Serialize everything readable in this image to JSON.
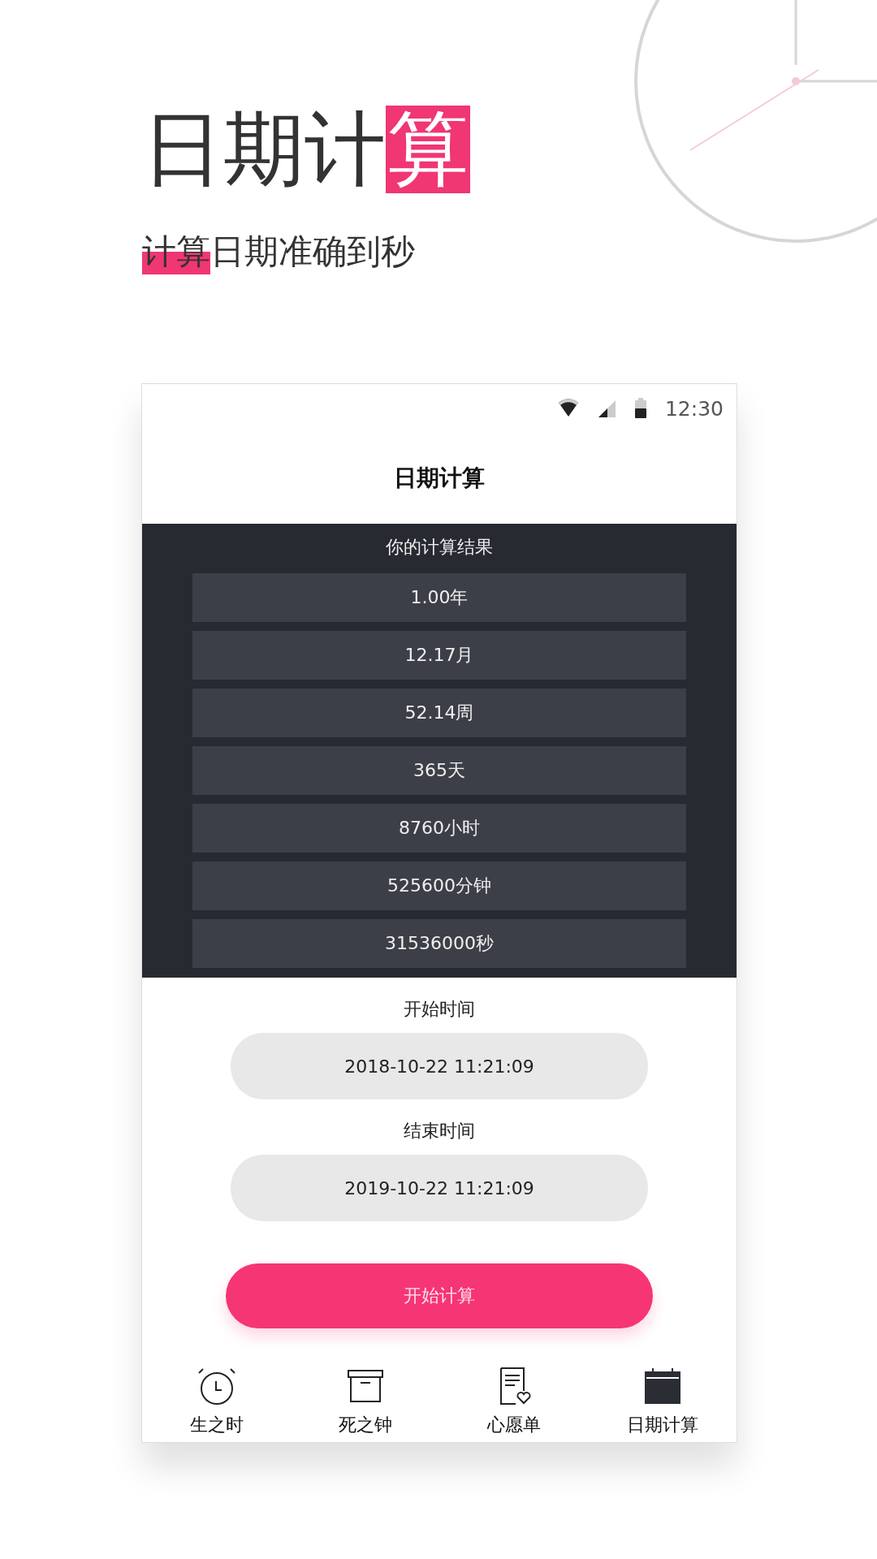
{
  "headline": {
    "text": "日期计",
    "highlight": "算"
  },
  "subtitle": {
    "highlight": "计算",
    "text": "日期准确到秒"
  },
  "status_bar": {
    "time": "12:30"
  },
  "app_title": "日期计算",
  "results": {
    "title": "你的计算结果",
    "rows": [
      "1.00年",
      "12.17月",
      "52.14周",
      "365天",
      "8760小时",
      "525600分钟",
      "31536000秒"
    ]
  },
  "start": {
    "label": "开始时间",
    "value": "2018-10-22 11:21:09"
  },
  "end": {
    "label": "结束时间",
    "value": "2019-10-22 11:21:09"
  },
  "button": "开始计算",
  "tabs": [
    {
      "label": "生之时",
      "kind": "alarm",
      "selected": false
    },
    {
      "label": "死之钟",
      "kind": "box",
      "selected": false
    },
    {
      "label": "心愿单",
      "kind": "wishlist",
      "selected": false
    },
    {
      "label": "日期计算",
      "kind": "calendar",
      "selected": true
    }
  ]
}
